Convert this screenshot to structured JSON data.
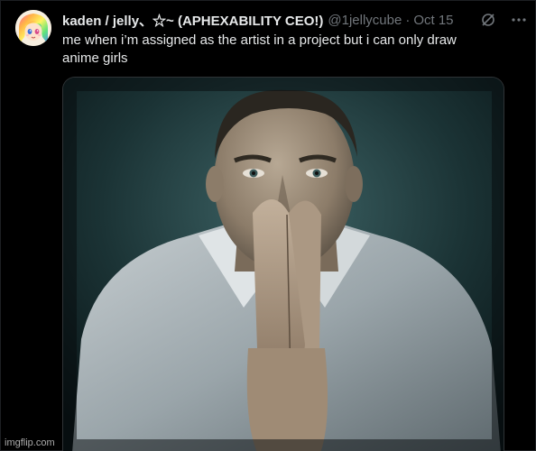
{
  "tweet": {
    "author_name": "kaden / jelly、☆~ (APHEXABILITY CEO!)",
    "handle": "@1jellycube",
    "separator": "·",
    "date": "Oct 15",
    "text": "me when i’m assigned as the artist in a project but i can only draw anime girls"
  },
  "icons": {
    "avatar": "anime-avatar",
    "grok": "grok-icon",
    "more": "more-options-icon",
    "media": "man-praying-hands-photo"
  },
  "watermark": "imgflip.com",
  "colors": {
    "background": "#000000",
    "text_primary": "#e7e9ea",
    "text_secondary": "#71767b",
    "border": "#2f3336"
  }
}
